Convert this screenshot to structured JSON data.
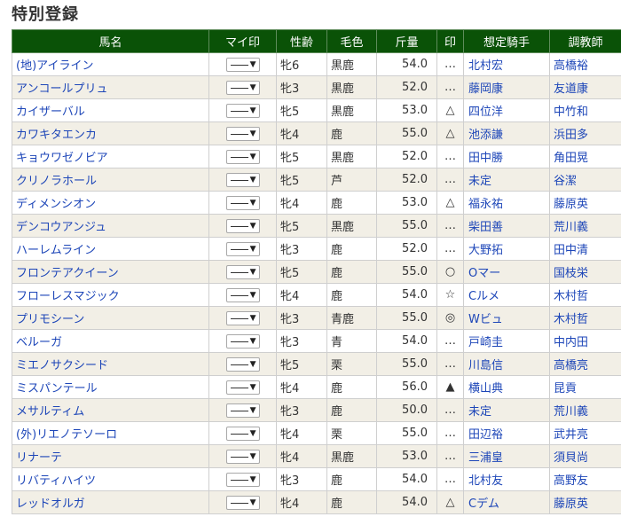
{
  "page": {
    "title": "特別登録"
  },
  "columns": [
    "馬名",
    "マイ印",
    "性齢",
    "毛色",
    "斤量",
    "印",
    "想定騎手",
    "調教師"
  ],
  "select": {
    "value": "——",
    "arrow": "▼"
  },
  "rows": [
    {
      "name": "(地)アイライン",
      "sexage": "牝6",
      "color": "黒鹿",
      "weight": "54.0",
      "mark": "…",
      "jockey": "北村宏",
      "trainer": "高橋裕"
    },
    {
      "name": "アンコールプリュ",
      "sexage": "牝3",
      "color": "黒鹿",
      "weight": "52.0",
      "mark": "…",
      "jockey": "藤岡康",
      "trainer": "友道康"
    },
    {
      "name": "カイザーバル",
      "sexage": "牝5",
      "color": "黒鹿",
      "weight": "53.0",
      "mark": "△",
      "jockey": "四位洋",
      "trainer": "中竹和"
    },
    {
      "name": "カワキタエンカ",
      "sexage": "牝4",
      "color": "鹿",
      "weight": "55.0",
      "mark": "△",
      "jockey": "池添謙",
      "trainer": "浜田多"
    },
    {
      "name": "キョウワゼノビア",
      "sexage": "牝5",
      "color": "黒鹿",
      "weight": "52.0",
      "mark": "…",
      "jockey": "田中勝",
      "trainer": "角田晃"
    },
    {
      "name": "クリノラホール",
      "sexage": "牝5",
      "color": "芦",
      "weight": "52.0",
      "mark": "…",
      "jockey": "未定",
      "trainer": "谷潔"
    },
    {
      "name": "ディメンシオン",
      "sexage": "牝4",
      "color": "鹿",
      "weight": "53.0",
      "mark": "△",
      "jockey": "福永祐",
      "trainer": "藤原英"
    },
    {
      "name": "デンコウアンジュ",
      "sexage": "牝5",
      "color": "黒鹿",
      "weight": "55.0",
      "mark": "…",
      "jockey": "柴田善",
      "trainer": "荒川義"
    },
    {
      "name": "ハーレムライン",
      "sexage": "牝3",
      "color": "鹿",
      "weight": "52.0",
      "mark": "…",
      "jockey": "大野拓",
      "trainer": "田中清"
    },
    {
      "name": "フロンテアクイーン",
      "sexage": "牝5",
      "color": "鹿",
      "weight": "55.0",
      "mark": "○",
      "jockey": "Oマー",
      "trainer": "国枝栄"
    },
    {
      "name": "フローレスマジック",
      "sexage": "牝4",
      "color": "鹿",
      "weight": "54.0",
      "mark": "☆",
      "jockey": "Cルメ",
      "trainer": "木村哲"
    },
    {
      "name": "プリモシーン",
      "sexage": "牝3",
      "color": "青鹿",
      "weight": "55.0",
      "mark": "◎",
      "jockey": "Wビュ",
      "trainer": "木村哲"
    },
    {
      "name": "ベルーガ",
      "sexage": "牝3",
      "color": "青",
      "weight": "54.0",
      "mark": "…",
      "jockey": "戸崎圭",
      "trainer": "中内田"
    },
    {
      "name": "ミエノサクシード",
      "sexage": "牝5",
      "color": "栗",
      "weight": "55.0",
      "mark": "…",
      "jockey": "川島信",
      "trainer": "高橋亮"
    },
    {
      "name": "ミスパンテール",
      "sexage": "牝4",
      "color": "鹿",
      "weight": "56.0",
      "mark": "▲",
      "jockey": "横山典",
      "trainer": "昆貢"
    },
    {
      "name": "メサルティム",
      "sexage": "牝3",
      "color": "鹿",
      "weight": "50.0",
      "mark": "…",
      "jockey": "未定",
      "trainer": "荒川義"
    },
    {
      "name": "(外)リエノテソーロ",
      "sexage": "牝4",
      "color": "栗",
      "weight": "55.0",
      "mark": "…",
      "jockey": "田辺裕",
      "trainer": "武井亮"
    },
    {
      "name": "リナーテ",
      "sexage": "牝4",
      "color": "黒鹿",
      "weight": "53.0",
      "mark": "…",
      "jockey": "三浦皇",
      "trainer": "須貝尚"
    },
    {
      "name": "リバティハイツ",
      "sexage": "牝3",
      "color": "鹿",
      "weight": "54.0",
      "mark": "…",
      "jockey": "北村友",
      "trainer": "高野友"
    },
    {
      "name": "レッドオルガ",
      "sexage": "牝4",
      "color": "鹿",
      "weight": "54.0",
      "mark": "△",
      "jockey": "Cデム",
      "trainer": "藤原英"
    }
  ]
}
